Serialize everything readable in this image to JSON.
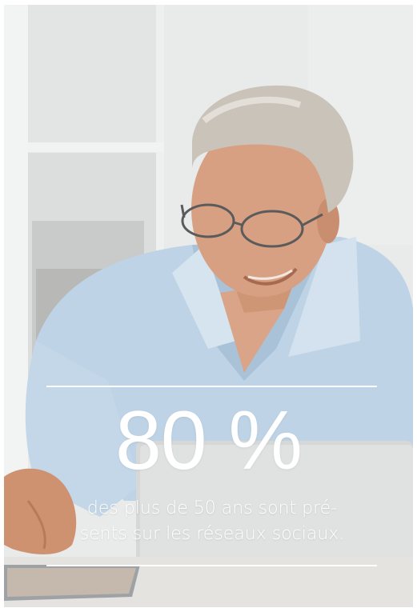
{
  "stat": {
    "value": "80 %",
    "caption_line1": "des plus de 50 ans sont pré-",
    "caption_line2": "sents sur les réseaux sociaux."
  },
  "photo": {
    "subject": "older-man-smiling-at-laptop-icon"
  },
  "colors": {
    "text": "#ffffff",
    "divider": "#ffffff",
    "background": "#e6e7e6",
    "shirt": "#bcd2e4"
  }
}
